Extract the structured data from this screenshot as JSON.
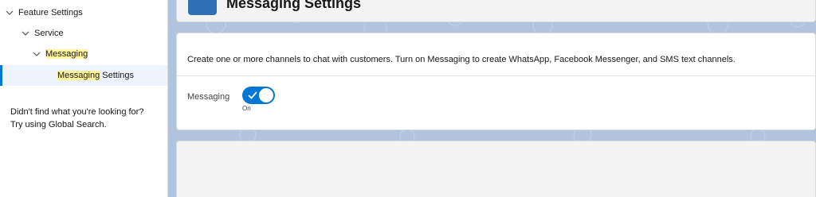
{
  "sidebar": {
    "tree": {
      "feature_settings": "Feature Settings",
      "service": "Service",
      "messaging": "Messaging",
      "messaging_settings_highlight": "Messaging",
      "messaging_settings_rest": " Settings"
    },
    "help_line1": "Didn't find what you're looking for?",
    "help_line2": "Try using Global Search."
  },
  "header": {
    "title": "Messaging Settings"
  },
  "content": {
    "description": "Create one or more channels to chat with customers. Turn on Messaging to create WhatsApp, Facebook Messenger, and SMS text channels.",
    "messaging_label": "Messaging",
    "toggle_state": "On",
    "toggle_on": true
  },
  "colors": {
    "accent": "#0176d3",
    "highlight": "#fff59d",
    "selected_bg": "#eef4ff",
    "main_bg": "#b0c4df"
  }
}
